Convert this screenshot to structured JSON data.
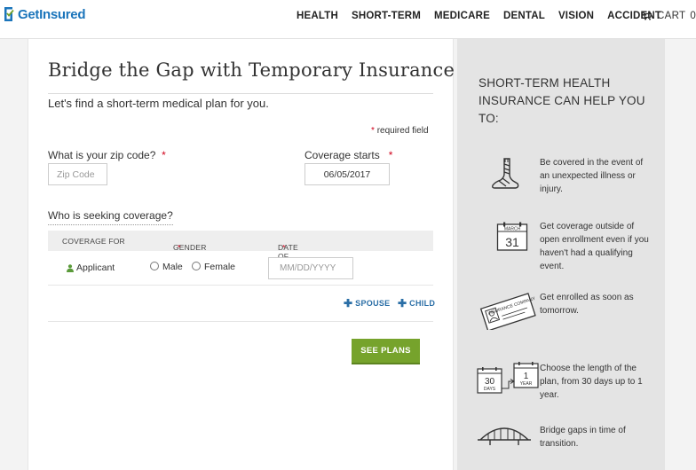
{
  "header": {
    "logo_text": "GetInsured",
    "nav": [
      "HEALTH",
      "SHORT-TERM",
      "MEDICARE",
      "DENTAL",
      "VISION",
      "ACCIDENT"
    ],
    "cart_label": "CART",
    "cart_count": "0"
  },
  "form": {
    "title": "Bridge the Gap with Temporary Insurance",
    "subtitle": "Let's find a short-term medical plan for you.",
    "required_note": "required field",
    "required_star": "*",
    "zip_label": "What is your zip code?",
    "zip_placeholder": "Zip Code",
    "coverage_label": "Coverage starts",
    "coverage_value": "06/05/2017",
    "seeking_label": "Who is seeking coverage?",
    "table_headers": {
      "coverage_for": "COVERAGE FOR",
      "gender": "GENDER",
      "dob": "DATE OF BIRTH"
    },
    "applicant": {
      "label": "Applicant",
      "male": "Male",
      "female": "Female",
      "dob_placeholder": "MM/DD/YYYY"
    },
    "add_spouse": "SPOUSE",
    "add_child": "CHILD",
    "submit": "SEE PLANS"
  },
  "sidebar": {
    "heading": "SHORT-TERM HEALTH INSURANCE CAN HELP YOU TO:",
    "benefits": [
      {
        "icon": "injured-leg-icon",
        "text": "Be covered in the event of an unexpected illness or injury."
      },
      {
        "icon": "calendar-icon",
        "text": "Get coverage outside of open enrollment even if you haven't had a qualifying event.",
        "calendar_month": "MARCH",
        "calendar_day": "31"
      },
      {
        "icon": "insurance-card-icon",
        "text": "Get enrolled as soon as tomorrow.",
        "card_text": "INSURANCE COMPANY"
      },
      {
        "icon": "duration-icon",
        "text": "Choose the length of the plan, from 30 days up to 1 year.",
        "days_num": "30",
        "days_label": "DAYS",
        "year_num": "1",
        "year_label": "YEAR"
      },
      {
        "icon": "bridge-icon",
        "text": "Bridge gaps in time of transition."
      }
    ]
  },
  "colors": {
    "brand_blue": "#1b75bb",
    "button_green": "#76a32c",
    "required_red": "#d0021b",
    "link_blue": "#2a6ea6"
  }
}
